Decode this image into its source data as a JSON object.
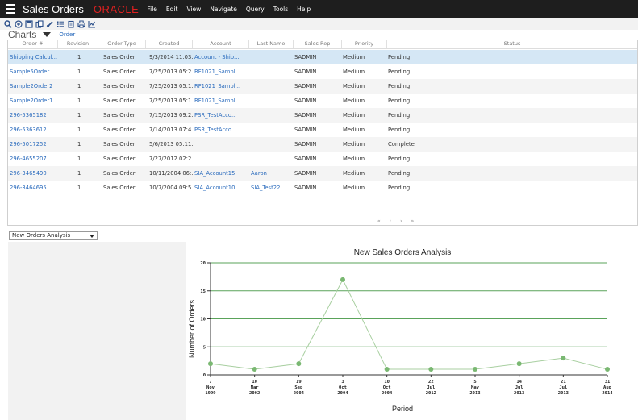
{
  "topbar": {
    "app_title": "Sales Orders",
    "brand": "ORACLE",
    "menu": [
      "File",
      "Edit",
      "View",
      "Navigate",
      "Query",
      "Tools",
      "Help"
    ]
  },
  "toolbar": {
    "icons": [
      "search-icon",
      "add-icon",
      "save-icon",
      "copy-icon",
      "edit-icon",
      "list-icon",
      "clipboard-icon",
      "print-icon",
      "chart-icon"
    ]
  },
  "charts_bar": {
    "label": "Charts",
    "tab": "Order"
  },
  "table": {
    "columns": [
      "Order #",
      "Revision",
      "Order Type",
      "Created",
      "Account",
      "Last Name",
      "Sales Rep",
      "Priority",
      "Status"
    ],
    "rows": [
      {
        "order": "Shipping Calcul...",
        "revision": "1",
        "type": "Sales Order",
        "created": "9/3/2014 11:03...",
        "account": "Account - Ship...",
        "last_name": "",
        "rep": "SADMIN",
        "priority": "Medium",
        "status": "Pending"
      },
      {
        "order": "Sample5Order",
        "revision": "1",
        "type": "Sales Order",
        "created": "7/25/2013 05:2...",
        "account": "RF1021_Sampl...",
        "last_name": "",
        "rep": "SADMIN",
        "priority": "Medium",
        "status": "Pending"
      },
      {
        "order": "Sample2Order2",
        "revision": "1",
        "type": "Sales Order",
        "created": "7/25/2013 05:1...",
        "account": "RF1021_Sampl...",
        "last_name": "",
        "rep": "SADMIN",
        "priority": "Medium",
        "status": "Pending"
      },
      {
        "order": "Sample2Order1",
        "revision": "1",
        "type": "Sales Order",
        "created": "7/25/2013 05:1...",
        "account": "RF1021_Sampl...",
        "last_name": "",
        "rep": "SADMIN",
        "priority": "Medium",
        "status": "Pending"
      },
      {
        "order": "296-5365182",
        "revision": "1",
        "type": "Sales Order",
        "created": "7/15/2013 09:2...",
        "account": "PSR_TestAcco...",
        "last_name": "",
        "rep": "SADMIN",
        "priority": "Medium",
        "status": "Pending"
      },
      {
        "order": "296-5363612",
        "revision": "1",
        "type": "Sales Order",
        "created": "7/14/2013 07:4...",
        "account": "PSR_TestAcco...",
        "last_name": "",
        "rep": "SADMIN",
        "priority": "Medium",
        "status": "Pending"
      },
      {
        "order": "296-5017252",
        "revision": "1",
        "type": "Sales Order",
        "created": "5/6/2013 05:11...",
        "account": "",
        "last_name": "",
        "rep": "SADMIN",
        "priority": "Medium",
        "status": "Complete"
      },
      {
        "order": "296-4655207",
        "revision": "1",
        "type": "Sales Order",
        "created": "7/27/2012 02:2...",
        "account": "",
        "last_name": "",
        "rep": "SADMIN",
        "priority": "Medium",
        "status": "Pending"
      },
      {
        "order": "296-3465490",
        "revision": "1",
        "type": "Sales Order",
        "created": "10/11/2004 06:...",
        "account": "SIA_Account15",
        "last_name": "Aaron",
        "rep": "SADMIN",
        "priority": "Medium",
        "status": "Pending"
      },
      {
        "order": "296-3464695",
        "revision": "1",
        "type": "Sales Order",
        "created": "10/7/2004 09:5...",
        "account": "SIA_Account10",
        "last_name": "SIA_Test22",
        "rep": "SADMIN",
        "priority": "Medium",
        "status": "Pending"
      }
    ],
    "pager": [
      "«",
      "‹",
      "›",
      "»"
    ]
  },
  "analysis_select": {
    "value": "New Orders Analysis"
  },
  "chart_data": {
    "type": "line",
    "title": "New Sales Orders Analysis",
    "xlabel": "Period",
    "ylabel": "Number of Orders",
    "ylim": [
      0,
      20
    ],
    "yticks": [
      0,
      5,
      10,
      15,
      20
    ],
    "grid": true,
    "categories": [
      "7\nNov\n1999",
      "10\nMar\n2002",
      "19\nSep\n2004",
      "3\nOct\n2004",
      "10\nOct\n2004",
      "22\nJul\n2012",
      "5\nMay\n2013",
      "14\nJul\n2013",
      "21\nJul\n2013",
      "31\nAug\n2014"
    ],
    "series": [
      {
        "values": [
          2,
          1,
          2,
          17,
          1,
          1,
          1,
          2,
          3,
          1
        ]
      }
    ],
    "colors": {
      "line": "#a8cfa0",
      "marker": "#7ab872",
      "grid": "#5aa35a"
    }
  }
}
